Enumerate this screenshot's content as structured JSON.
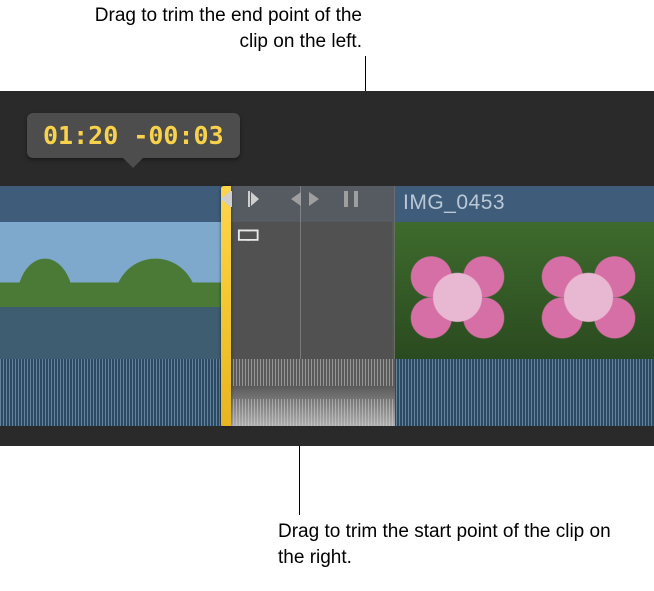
{
  "callouts": {
    "top": "Drag to trim the end point of the clip on the left.",
    "bottom": "Drag to trim the start point of the clip on the right."
  },
  "tooltip": {
    "timecode": "01:20",
    "offset": "-00:03"
  },
  "clip": {
    "right_name": "IMG_0453"
  }
}
